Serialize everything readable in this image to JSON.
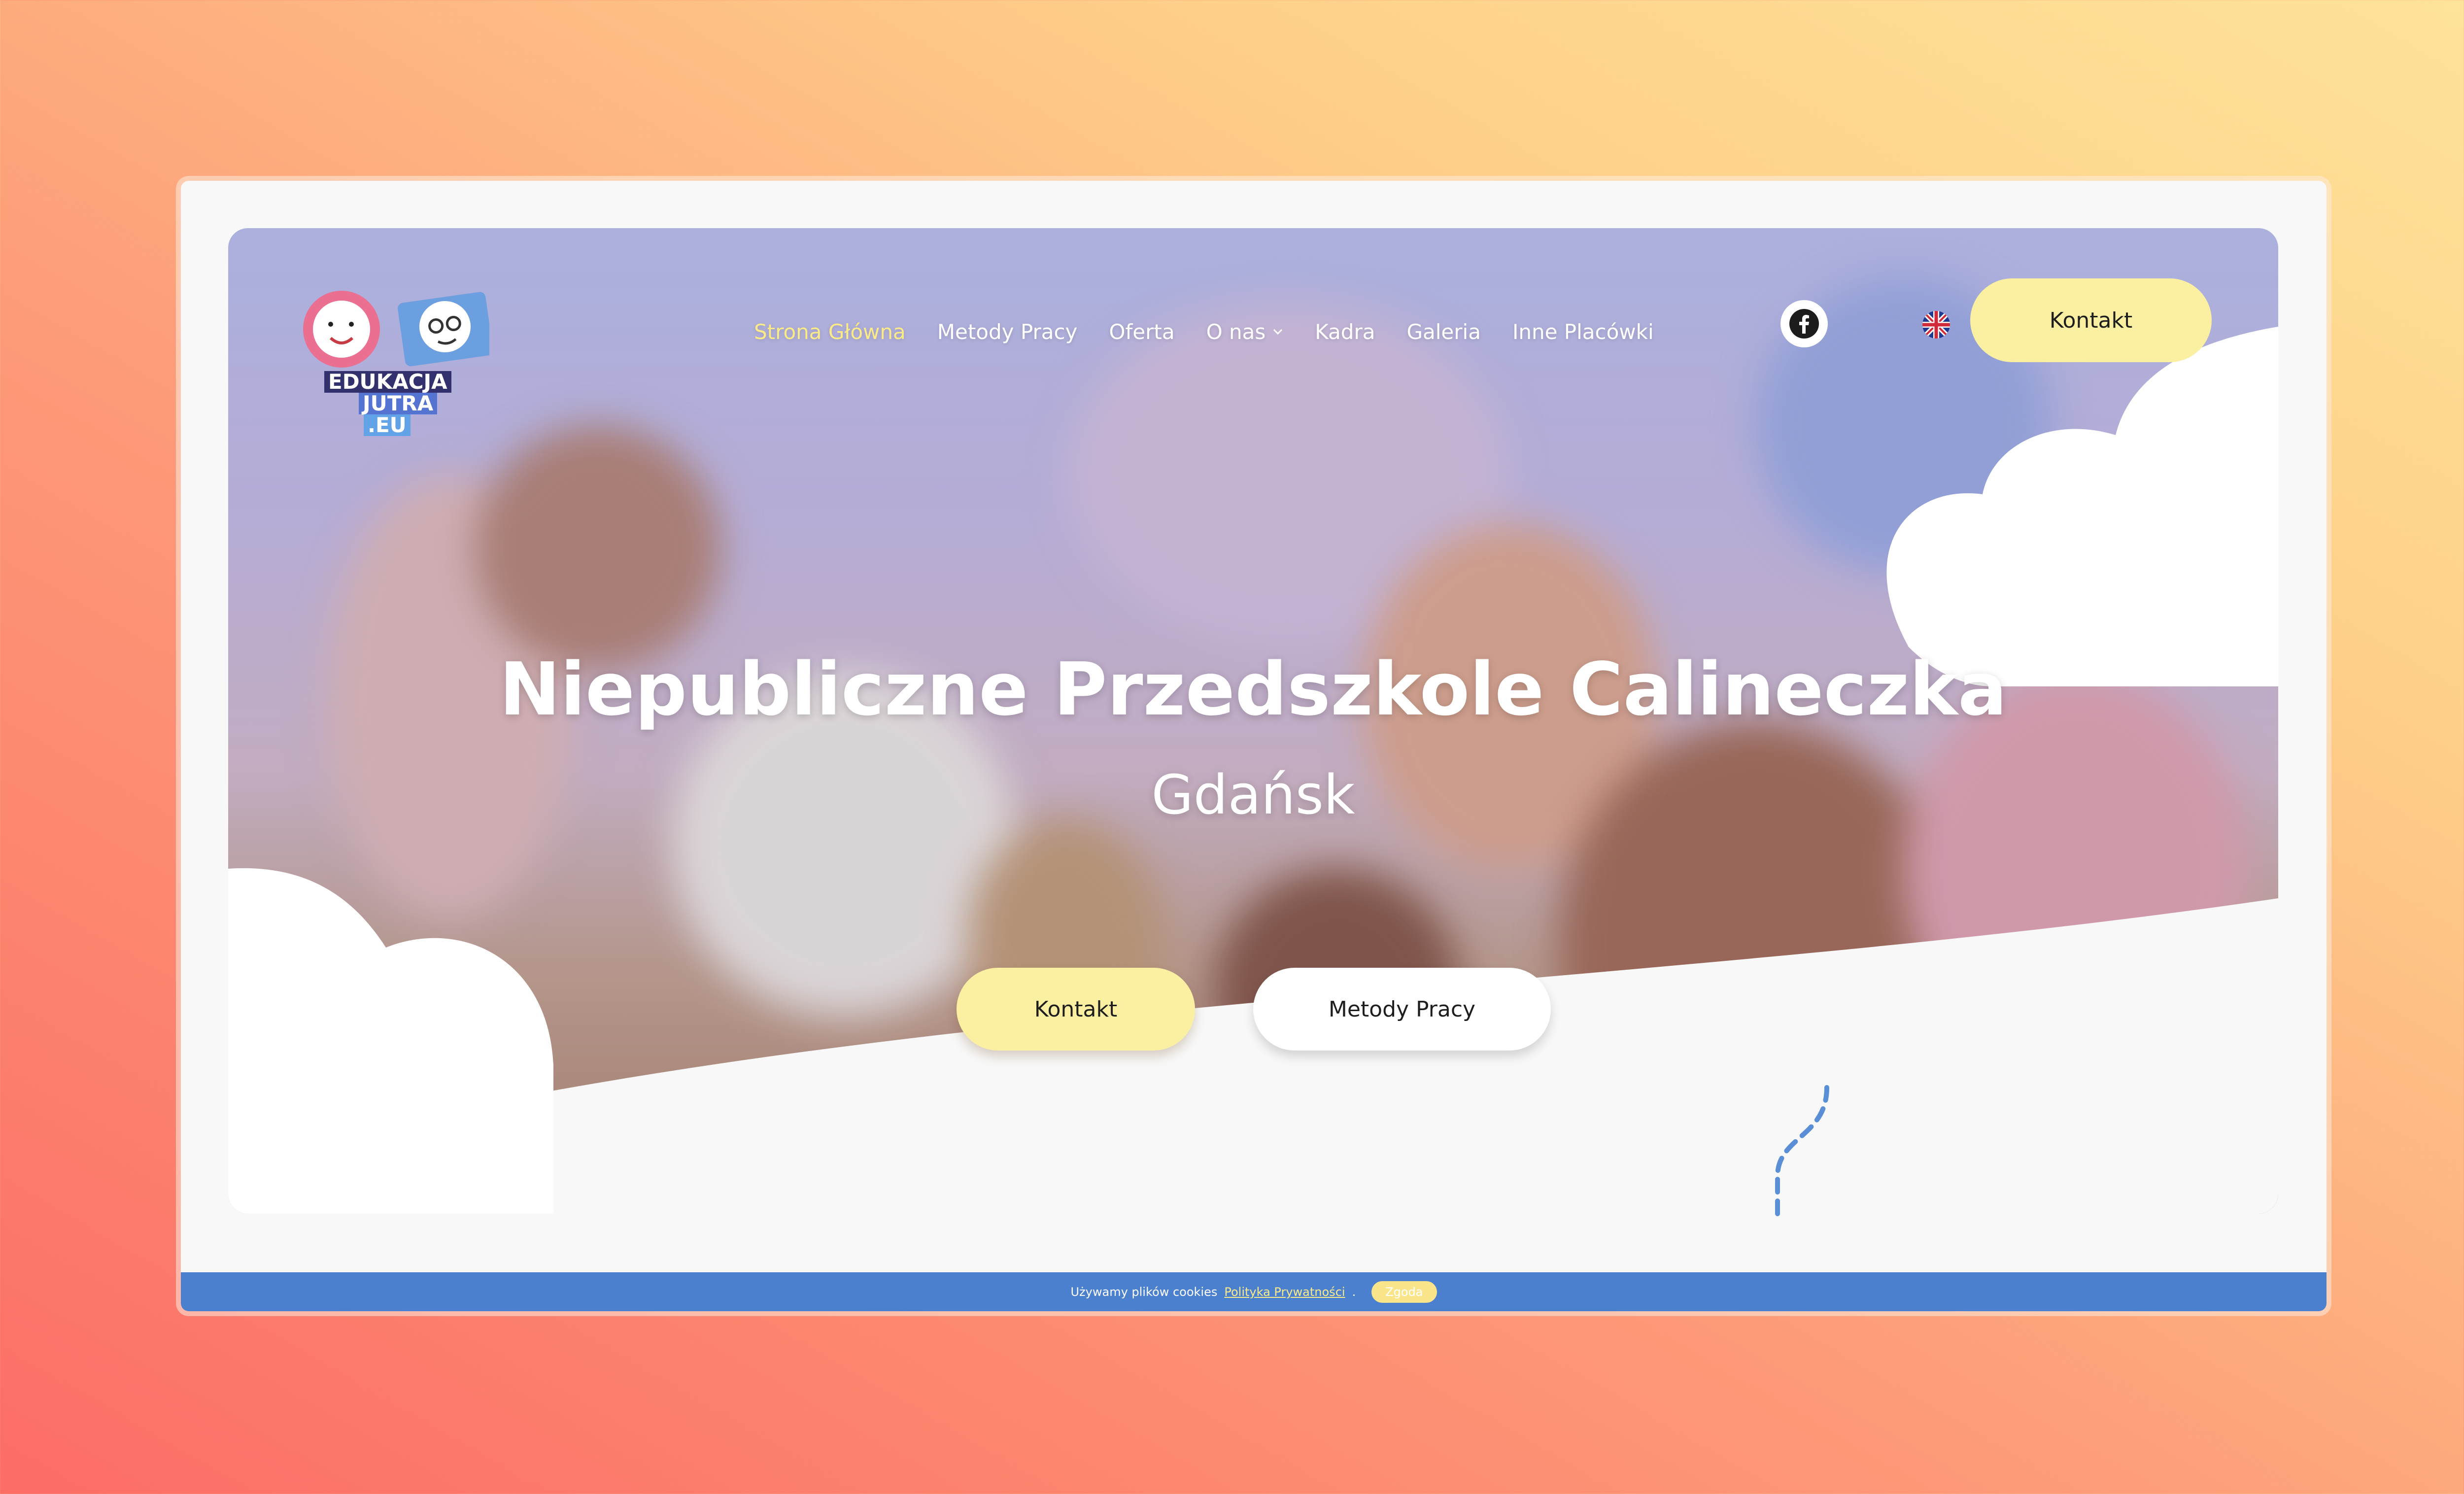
{
  "site": {
    "logo": {
      "line1": "EDUKACJA",
      "line2": "JUTRA",
      "line3": ".EU"
    },
    "nav": {
      "items": [
        {
          "label": "Strona Główna",
          "active": true
        },
        {
          "label": "Metody Pracy",
          "active": false
        },
        {
          "label": "Oferta",
          "active": false
        },
        {
          "label": "O nas",
          "active": false,
          "has_dropdown": true
        },
        {
          "label": "Kadra",
          "active": false
        },
        {
          "label": "Galeria",
          "active": false
        },
        {
          "label": "Inne Placówki",
          "active": false
        }
      ]
    },
    "header_icons": {
      "social": "facebook-icon",
      "language": "uk-flag-icon"
    },
    "header_button": "Kontakt"
  },
  "hero": {
    "title": "Niepubliczne Przedszkole Calineczka",
    "subtitle": "Gdańsk",
    "primary_button": "Kontakt",
    "secondary_button": "Metody Pracy"
  },
  "cookie_bar": {
    "text": "Używamy plików cookies",
    "link": "Polityka Prywatności",
    "after_link": ".",
    "button": "Zgoda"
  },
  "colors": {
    "accent_yellow": "#fbf0a2",
    "active_nav": "#fbeb88",
    "cookie_bar": "#4b80cf",
    "navy": "#33306e"
  }
}
